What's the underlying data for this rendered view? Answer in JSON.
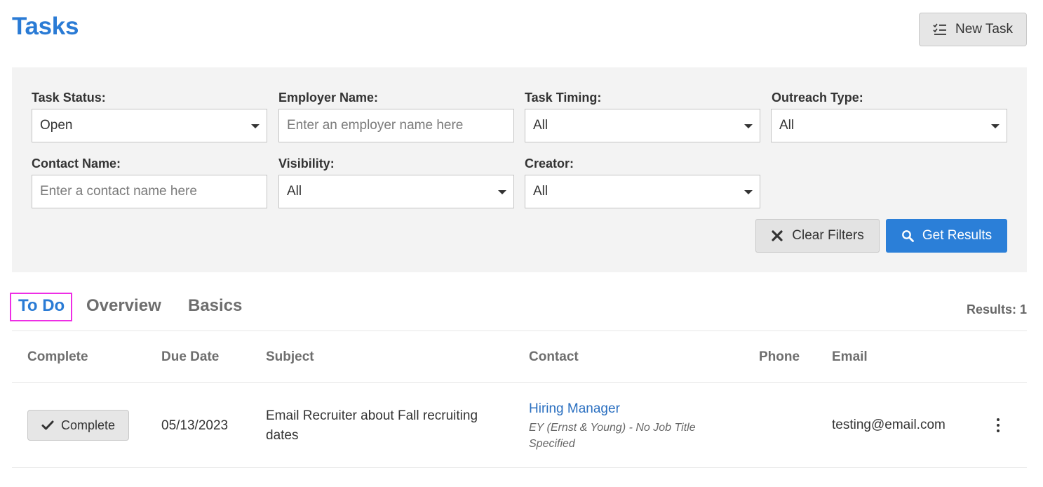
{
  "page": {
    "title": "Tasks"
  },
  "header": {
    "new_task_label": "New Task",
    "new_task_icon": "checklist-icon"
  },
  "filters": {
    "task_status": {
      "label": "Task Status:",
      "value": "Open"
    },
    "employer_name": {
      "label": "Employer Name:",
      "placeholder": "Enter an employer name here"
    },
    "task_timing": {
      "label": "Task Timing:",
      "value": "All"
    },
    "outreach_type": {
      "label": "Outreach Type:",
      "value": "All"
    },
    "contact_name": {
      "label": "Contact Name:",
      "placeholder": "Enter a contact name here"
    },
    "visibility": {
      "label": "Visibility:",
      "value": "All"
    },
    "creator": {
      "label": "Creator:",
      "value": "All"
    },
    "clear_label": "Clear Filters",
    "get_results_label": "Get Results"
  },
  "tabs": [
    {
      "label": "To Do",
      "active": true
    },
    {
      "label": "Overview",
      "active": false
    },
    {
      "label": "Basics",
      "active": false
    }
  ],
  "results_text": "Results: 1",
  "table": {
    "columns": [
      "Complete",
      "Due Date",
      "Subject",
      "Contact",
      "Phone",
      "Email"
    ],
    "rows": [
      {
        "complete_label": "Complete",
        "due_date": "05/13/2023",
        "subject": "Email Recruiter about Fall recruiting dates",
        "contact_name": "Hiring Manager",
        "contact_detail": "EY (Ernst & Young) - No Job Title Specified",
        "phone": "",
        "email": "testing@email.com"
      }
    ]
  },
  "colors": {
    "accent": "#2a7bd5",
    "primary_button": "#2b7fd8",
    "filter_bg": "#f3f3f3",
    "tab_highlight": "#ee2ee5"
  }
}
